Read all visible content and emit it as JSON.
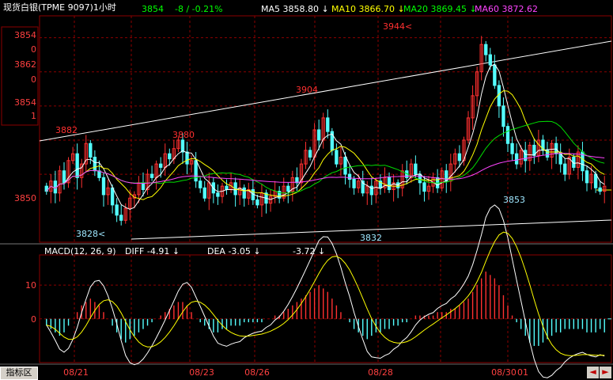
{
  "header": {
    "title": "现货白银(TPME 9097)1小时",
    "price": "3854",
    "change": "-8 / -0.21%",
    "ma": [
      {
        "label": "MA5 3858.80 ↓",
        "color": "#ffffff"
      },
      {
        "label": "MA10 3866.70 ↓",
        "color": "#ffff00"
      },
      {
        "label": "MA20 3869.45 ↓",
        "color": "#00ff00"
      },
      {
        "label": "MA60 3872.62",
        "color": "#ff44ff"
      }
    ]
  },
  "colors": {
    "up": "#ff3030",
    "down": "#54ffff",
    "grid": "#8b0000",
    "ma5": "#ffffff",
    "ma10": "#ffff00",
    "ma20": "#00dd00",
    "ma60": "#ff44ff"
  },
  "macd_header": {
    "label": "MACD(12, 26, 9)",
    "diff": "DIFF  -4.91 ↓",
    "dea": "DEA  -3.05 ↓",
    "macd": "-3.72 ↓"
  },
  "footer": {
    "indicator_tab": "指标区",
    "left_arrow": "◄",
    "right_arrow": "►"
  },
  "chart_data": {
    "type": "candlestick",
    "price_axis_ticks": [
      "3854",
      "0",
      "3862",
      "0",
      "3854",
      "1",
      "3850"
    ],
    "date_ticks": [
      "08/21",
      "08/23",
      "08/26",
      "08/28",
      "08/30",
      "01"
    ],
    "annotations": [
      {
        "text": "3882"
      },
      {
        "text": "3880"
      },
      {
        "text": "3904"
      },
      {
        "text": "3944<"
      },
      {
        "text": "3828<"
      },
      {
        "text": "3832"
      },
      {
        "text": "3853"
      }
    ],
    "price_range": [
      3822,
      3950
    ],
    "closes": [
      3850,
      3856,
      3849,
      3862,
      3855,
      3868,
      3872,
      3858,
      3866,
      3878,
      3870,
      3862,
      3858,
      3848,
      3852,
      3842,
      3836,
      3833,
      3840,
      3846,
      3848,
      3855,
      3851,
      3860,
      3858,
      3866,
      3864,
      3872,
      3869,
      3875,
      3880,
      3873,
      3866,
      3868,
      3856,
      3852,
      3846,
      3855,
      3849,
      3847,
      3853,
      3851,
      3855,
      3848,
      3852,
      3846,
      3851,
      3845,
      3842,
      3849,
      3843,
      3847,
      3850,
      3846,
      3853,
      3850,
      3858,
      3855,
      3866,
      3874,
      3870,
      3886,
      3880,
      3893,
      3885,
      3874,
      3866,
      3870,
      3860,
      3857,
      3852,
      3856,
      3849,
      3853,
      3848,
      3856,
      3852,
      3858,
      3851,
      3855,
      3852,
      3862,
      3858,
      3866,
      3860,
      3855,
      3850,
      3853,
      3858,
      3852,
      3862,
      3856,
      3866,
      3872,
      3868,
      3880,
      3893,
      3906,
      3920,
      3936,
      3930,
      3924,
      3912,
      3900,
      3888,
      3878,
      3872,
      3866,
      3874,
      3868,
      3877,
      3871,
      3880,
      3874,
      3870,
      3878,
      3872,
      3866,
      3860,
      3870,
      3864,
      3873,
      3862,
      3855,
      3860,
      3852,
      3850,
      3853
    ],
    "macd_axis_ticks": [
      "10",
      "0"
    ],
    "macd_range": [
      -12,
      18
    ],
    "macd_hist": [
      -2,
      -3,
      -4,
      -5,
      -4,
      -2,
      0,
      2,
      4,
      5,
      6,
      5,
      4,
      2,
      0,
      -2,
      -4,
      -6,
      -7,
      -6,
      -5,
      -4,
      -3,
      -2,
      -1,
      0,
      1,
      2,
      3,
      4,
      5,
      5,
      4,
      2,
      0,
      -1,
      -2,
      -3,
      -4,
      -4,
      -3,
      -3,
      -2,
      -2,
      -2,
      -1,
      -1,
      -1,
      -1,
      -1,
      0,
      0,
      1,
      1,
      2,
      3,
      4,
      5,
      6,
      7,
      8,
      9,
      10,
      9,
      8,
      6,
      4,
      2,
      0,
      -1,
      -3,
      -4,
      -5,
      -6,
      -5,
      -4,
      -4,
      -3,
      -3,
      -2,
      -2,
      -1,
      -1,
      0,
      1,
      1,
      1,
      1,
      1,
      2,
      2,
      2,
      3,
      3,
      4,
      5,
      6,
      8,
      10,
      12,
      14,
      13,
      12,
      10,
      7,
      4,
      1,
      -1,
      -3,
      -5,
      -7,
      -8,
      -8,
      -7,
      -6,
      -5,
      -4,
      -4,
      -3,
      -3,
      -3,
      -3,
      -3,
      -4,
      -4,
      -4,
      -3,
      -4
    ]
  }
}
